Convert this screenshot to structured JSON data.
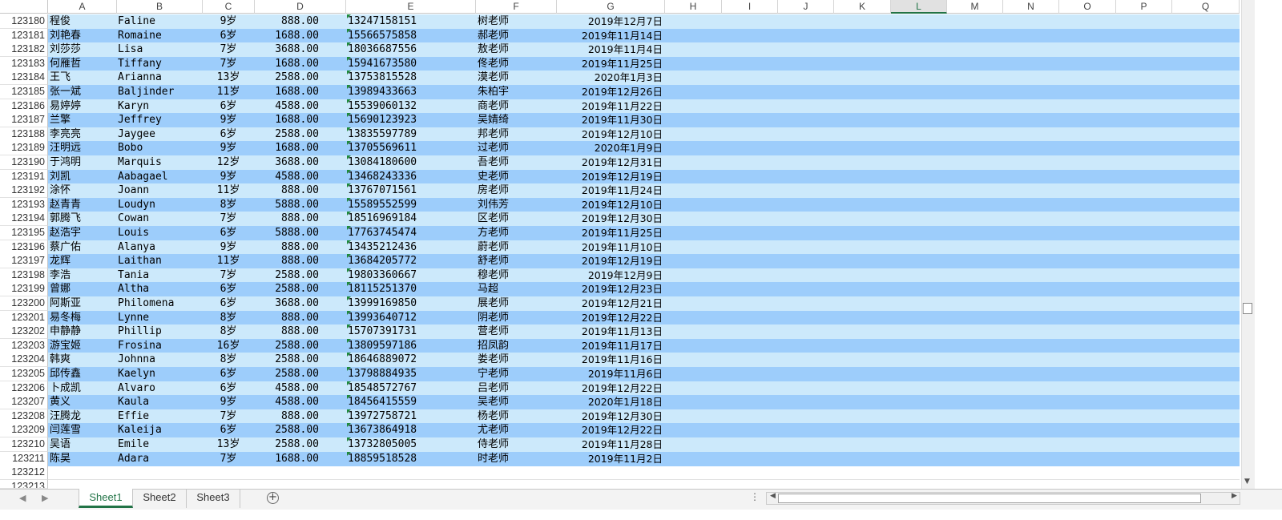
{
  "columns": [
    "A",
    "B",
    "C",
    "D",
    "E",
    "F",
    "G",
    "H",
    "I",
    "J",
    "K",
    "L",
    "M",
    "N",
    "O",
    "P",
    "Q"
  ],
  "selected_column": "L",
  "rows": [
    {
      "n": "123180",
      "a": "程俊",
      "b": "Faline",
      "c": "9岁",
      "d": "888.00",
      "e": "13247158151",
      "f": "树老师",
      "g": "2019年12月7日"
    },
    {
      "n": "123181",
      "a": "刘艳春",
      "b": "Romaine",
      "c": "6岁",
      "d": "1688.00",
      "e": "15566575858",
      "f": "郝老师",
      "g": "2019年11月14日"
    },
    {
      "n": "123182",
      "a": "刘莎莎",
      "b": "Lisa",
      "c": "7岁",
      "d": "3688.00",
      "e": "18036687556",
      "f": "敖老师",
      "g": "2019年11月4日"
    },
    {
      "n": "123183",
      "a": "何雁哲",
      "b": "Tiffany",
      "c": "7岁",
      "d": "1688.00",
      "e": "15941673580",
      "f": "佟老师",
      "g": "2019年11月25日"
    },
    {
      "n": "123184",
      "a": "王飞",
      "b": "Arianna",
      "c": "13岁",
      "d": "2588.00",
      "e": "13753815528",
      "f": "漠老师",
      "g": "2020年1月3日"
    },
    {
      "n": "123185",
      "a": "张一斌",
      "b": "Baljinder",
      "c": "11岁",
      "d": "1688.00",
      "e": "13989433663",
      "f": "朱柏宇",
      "g": "2019年12月26日"
    },
    {
      "n": "123186",
      "a": "易婷婷",
      "b": "Karyn",
      "c": "6岁",
      "d": "4588.00",
      "e": "15539060132",
      "f": "商老师",
      "g": "2019年11月22日"
    },
    {
      "n": "123187",
      "a": "兰擎",
      "b": "Jeffrey",
      "c": "9岁",
      "d": "1688.00",
      "e": "15690123923",
      "f": "吴婧绮",
      "g": "2019年11月30日"
    },
    {
      "n": "123188",
      "a": "李亮亮",
      "b": "Jaygee",
      "c": "6岁",
      "d": "2588.00",
      "e": "13835597789",
      "f": "邦老师",
      "g": "2019年12月10日"
    },
    {
      "n": "123189",
      "a": "汪明远",
      "b": "Bobo",
      "c": "9岁",
      "d": "1688.00",
      "e": "13705569611",
      "f": "过老师",
      "g": "2020年1月9日"
    },
    {
      "n": "123190",
      "a": "于鸿明",
      "b": "Marquis",
      "c": "12岁",
      "d": "3688.00",
      "e": "13084180600",
      "f": "吾老师",
      "g": "2019年12月31日"
    },
    {
      "n": "123191",
      "a": "刘凯",
      "b": "Aabagael",
      "c": "9岁",
      "d": "4588.00",
      "e": "13468243336",
      "f": "史老师",
      "g": "2019年12月19日"
    },
    {
      "n": "123192",
      "a": "涂怀",
      "b": "Joann",
      "c": "11岁",
      "d": "888.00",
      "e": "13767071561",
      "f": "房老师",
      "g": "2019年11月24日"
    },
    {
      "n": "123193",
      "a": "赵青青",
      "b": "Loudyn",
      "c": "8岁",
      "d": "5888.00",
      "e": "15589552599",
      "f": "刘伟芳",
      "g": "2019年12月10日"
    },
    {
      "n": "123194",
      "a": "郭腾飞",
      "b": "Cowan",
      "c": "7岁",
      "d": "888.00",
      "e": "18516969184",
      "f": "区老师",
      "g": "2019年12月30日"
    },
    {
      "n": "123195",
      "a": "赵浩宇",
      "b": "Louis",
      "c": "6岁",
      "d": "5888.00",
      "e": "17763745474",
      "f": "方老师",
      "g": "2019年11月25日"
    },
    {
      "n": "123196",
      "a": "蔡广佑",
      "b": "Alanya",
      "c": "9岁",
      "d": "888.00",
      "e": "13435212436",
      "f": "蔚老师",
      "g": "2019年11月10日"
    },
    {
      "n": "123197",
      "a": "龙辉",
      "b": "Laithan",
      "c": "11岁",
      "d": "888.00",
      "e": "13684205772",
      "f": "舒老师",
      "g": "2019年12月19日"
    },
    {
      "n": "123198",
      "a": "李浩",
      "b": "Tania",
      "c": "7岁",
      "d": "2588.00",
      "e": "19803360667",
      "f": "穆老师",
      "g": "2019年12月9日"
    },
    {
      "n": "123199",
      "a": "曾娜",
      "b": "Altha",
      "c": "6岁",
      "d": "2588.00",
      "e": "18115251370",
      "f": "马超",
      "g": "2019年12月23日"
    },
    {
      "n": "123200",
      "a": "阿斯亚",
      "b": "Philomena",
      "c": "6岁",
      "d": "3688.00",
      "e": "13999169850",
      "f": "展老师",
      "g": "2019年12月21日"
    },
    {
      "n": "123201",
      "a": "易冬梅",
      "b": "Lynne",
      "c": "8岁",
      "d": "888.00",
      "e": "13993640712",
      "f": "阴老师",
      "g": "2019年12月22日"
    },
    {
      "n": "123202",
      "a": "申静静",
      "b": "Phillip",
      "c": "8岁",
      "d": "888.00",
      "e": "15707391731",
      "f": "营老师",
      "g": "2019年11月13日"
    },
    {
      "n": "123203",
      "a": "游宝姬",
      "b": "Frosina",
      "c": "16岁",
      "d": "2588.00",
      "e": "13809597186",
      "f": "招凤韵",
      "g": "2019年11月17日"
    },
    {
      "n": "123204",
      "a": "韩爽",
      "b": "Johnna",
      "c": "8岁",
      "d": "2588.00",
      "e": "18646889072",
      "f": "娄老师",
      "g": "2019年11月16日"
    },
    {
      "n": "123205",
      "a": "邱传鑫",
      "b": "Kaelyn",
      "c": "6岁",
      "d": "2588.00",
      "e": "13798884935",
      "f": "宁老师",
      "g": "2019年11月6日"
    },
    {
      "n": "123206",
      "a": "卜成凯",
      "b": "Alvaro",
      "c": "6岁",
      "d": "4588.00",
      "e": "18548572767",
      "f": "吕老师",
      "g": "2019年12月22日"
    },
    {
      "n": "123207",
      "a": "黄义",
      "b": "Kaula",
      "c": "9岁",
      "d": "4588.00",
      "e": "18456415559",
      "f": "吴老师",
      "g": "2020年1月18日"
    },
    {
      "n": "123208",
      "a": "汪腾龙",
      "b": "Effie",
      "c": "7岁",
      "d": "888.00",
      "e": "13972758721",
      "f": "杨老师",
      "g": "2019年12月30日"
    },
    {
      "n": "123209",
      "a": "闫莲雪",
      "b": "Kaleija",
      "c": "6岁",
      "d": "2588.00",
      "e": "13673864918",
      "f": "尤老师",
      "g": "2019年12月22日"
    },
    {
      "n": "123210",
      "a": "吴语",
      "b": "Emile",
      "c": "13岁",
      "d": "2588.00",
      "e": "13732805005",
      "f": "侍老师",
      "g": "2019年11月28日"
    },
    {
      "n": "123211",
      "a": "陈昊",
      "b": "Adara",
      "c": "7岁",
      "d": "1688.00",
      "e": "18859518528",
      "f": "时老师",
      "g": "2019年11月2日"
    }
  ],
  "empty_rows": [
    "123212",
    "123213"
  ],
  "tabs": [
    "Sheet1",
    "Sheet2",
    "Sheet3"
  ],
  "active_tab": "Sheet1",
  "icons": {
    "add_sheet": "plus-circle-icon",
    "nav_prev": "triangle-left-icon",
    "nav_next": "triangle-right-icon"
  },
  "colors": {
    "band_light": "#cce9fb",
    "band_dark": "#9dcdfb",
    "accent": "#217346",
    "marker": "#1e8b3c"
  }
}
